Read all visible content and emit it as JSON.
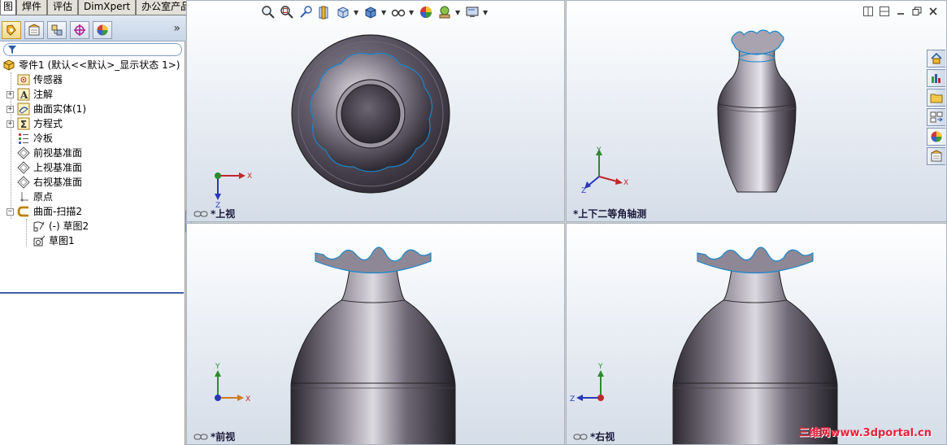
{
  "top_tabs": [
    "图",
    "焊件",
    "评估",
    "DimXpert",
    "办公室产品"
  ],
  "feature_tree": {
    "root": "零件1   (默认<<默认>_显示状态 1>)",
    "items": [
      {
        "label": "传感器",
        "icon": "sensor-icon",
        "expandable": false
      },
      {
        "label": "注解",
        "icon": "annotation-icon",
        "expandable": true
      },
      {
        "label": "曲面实体(1)",
        "icon": "surface-bodies-icon",
        "expandable": true
      },
      {
        "label": "方程式",
        "icon": "equations-icon",
        "expandable": true
      },
      {
        "label": "冷板",
        "icon": "material-icon",
        "expandable": false
      },
      {
        "label": "前视基准面",
        "icon": "plane-icon",
        "expandable": false
      },
      {
        "label": "上视基准面",
        "icon": "plane-icon",
        "expandable": false
      },
      {
        "label": "右视基准面",
        "icon": "plane-icon",
        "expandable": false
      },
      {
        "label": "原点",
        "icon": "origin-icon",
        "expandable": false
      },
      {
        "label": "曲面-扫描2",
        "icon": "surface-sweep-icon",
        "expandable": true
      },
      {
        "label": "(-) 草图2",
        "icon": "sketch-icon",
        "expandable": false
      },
      {
        "label": "草图1",
        "icon": "sketch-icon",
        "expandable": false
      }
    ]
  },
  "viewports": {
    "top": {
      "label": "*上视"
    },
    "iso": {
      "label": "*上下二等角轴测"
    },
    "front": {
      "label": "*前视"
    },
    "right": {
      "label": "*右视"
    }
  },
  "triad": {
    "x": "X",
    "y": "Y",
    "z": "Z"
  },
  "panel_expand": "»",
  "watermark": "三维网www.3dportal.cn",
  "colors": {
    "vase_edge": "#1b86c9",
    "axis_x": "#c0282c",
    "axis_y": "#2d8a2d",
    "axis_z": "#2838b8"
  }
}
